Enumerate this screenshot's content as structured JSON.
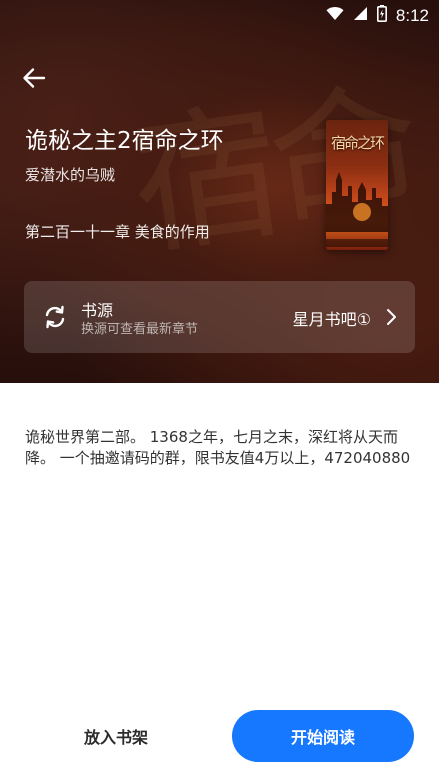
{
  "status_bar": {
    "time": "8:12",
    "icons": [
      "wifi-icon",
      "signal-icon",
      "battery-icon"
    ]
  },
  "nav": {
    "back_icon": "back-arrow-icon"
  },
  "book": {
    "title": "诡秘之主2宿命之环",
    "author": "爱潜水的乌贼",
    "latest_chapter": "第二百一十一章 美食的作用",
    "cover_text": "宿命之环"
  },
  "source": {
    "label": "书源",
    "hint": "换源可查看最新章节",
    "name": "星月书吧①",
    "icon": "swap-refresh-icon",
    "chevron": "chevron-right-icon"
  },
  "description": "诡秘世界第二部。 1368之年，七月之末，深红将从天而降。 一个抽邀请码的群，限书友值4万以上，472040880",
  "actions": {
    "add_to_shelf": "放入书架",
    "start_reading": "开始阅读"
  },
  "colors": {
    "accent": "#1677ff",
    "hero_bg": "#3a1a14",
    "text_dark": "#333333"
  }
}
